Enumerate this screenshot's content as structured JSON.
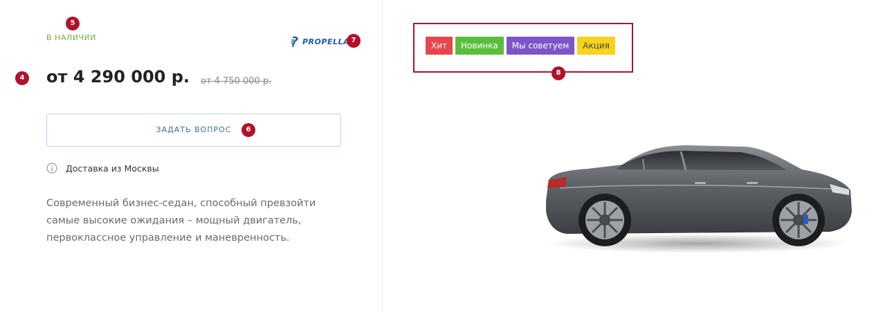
{
  "product": {
    "stock_status": "В НАЛИЧИИ",
    "brand": "PROPELLA",
    "price_current": "от 4 290 000 р.",
    "price_old": "от 4 750 000 р.",
    "ask_button_label": "ЗАДАТЬ ВОПРОС",
    "delivery_text": "Доставка из Москвы",
    "description": "Современный бизнес-седан, способный превзойти самые высокие ожидания – мощный двигатель, первоклассное управление и маневренность."
  },
  "badges": [
    {
      "label": "Хит",
      "color": "#e5474e"
    },
    {
      "label": "Новинка",
      "color": "#5bbd3c"
    },
    {
      "label": "Мы советуем",
      "color": "#7c55c8"
    },
    {
      "label": "Акция",
      "color": "#f7d21f"
    }
  ],
  "markers": {
    "m4": "4",
    "m5": "5",
    "m6": "6",
    "m7": "7",
    "m8": "8"
  },
  "colors": {
    "accent_marker": "#b3112b",
    "stock_green": "#7aab46",
    "brand_blue": "#1f5aa6",
    "button_border": "#b9d3e6"
  },
  "icons": {
    "delivery": "info-icon",
    "brand": "propella-logo-icon",
    "product": "car-image"
  }
}
